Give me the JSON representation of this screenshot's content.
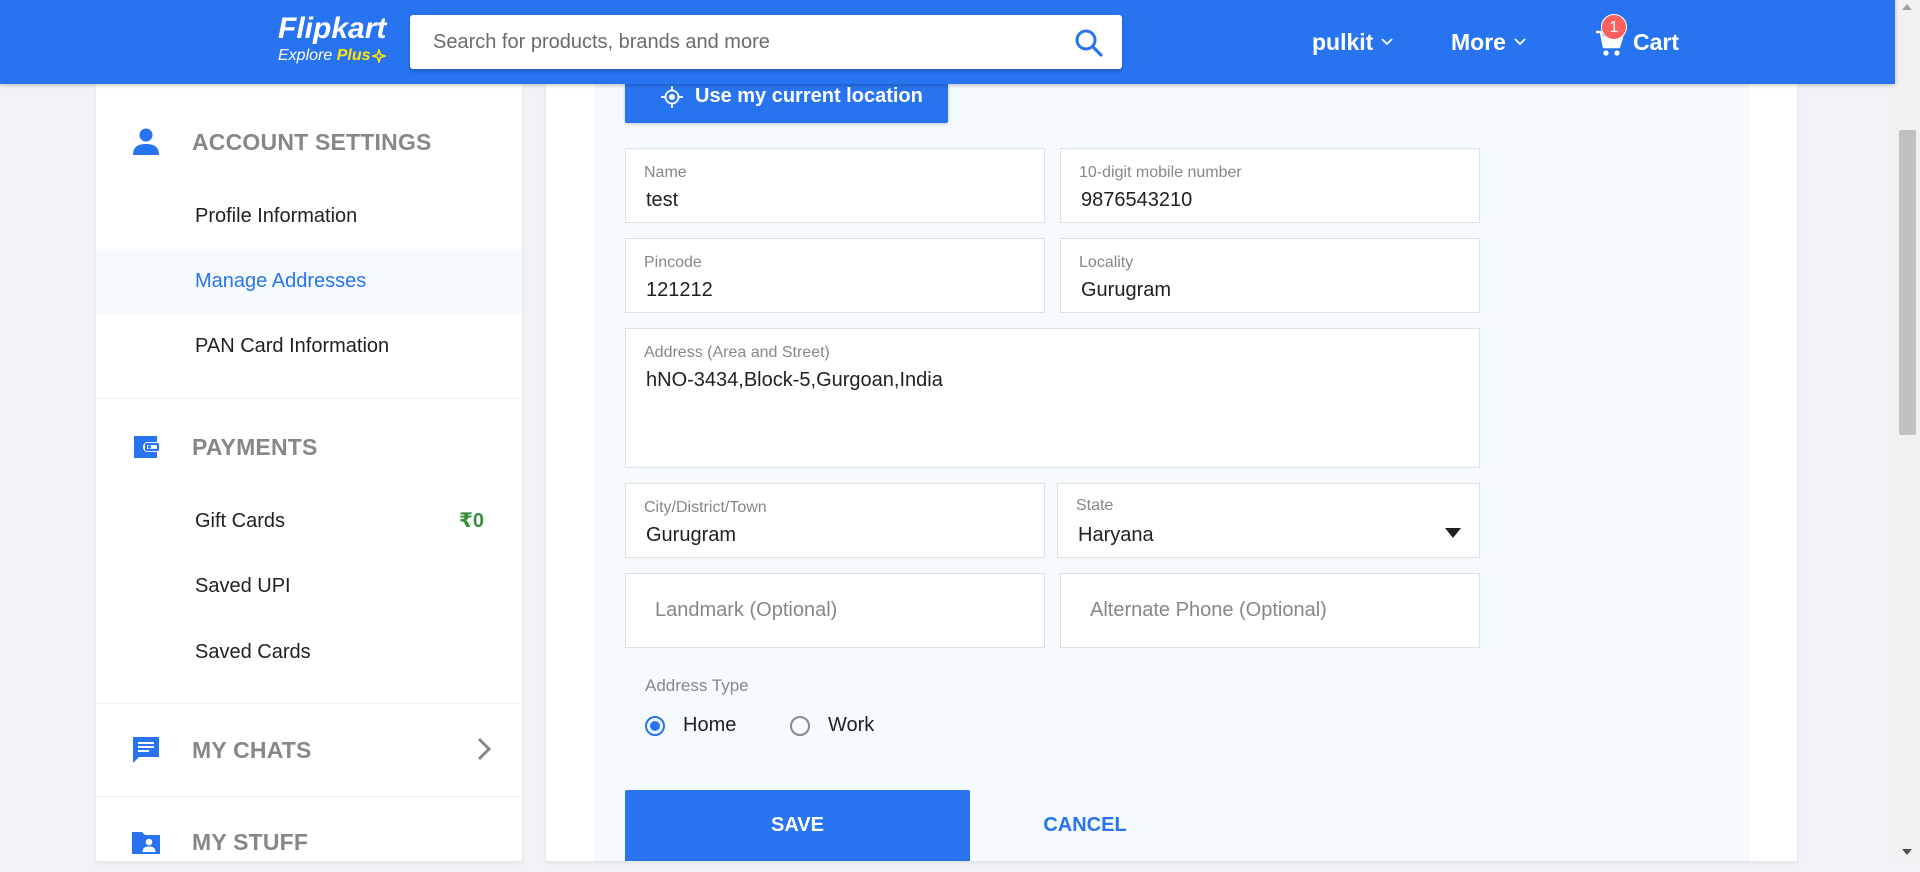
{
  "header": {
    "logo_main": "Flipkart",
    "logo_sub_prefix": "Explore ",
    "logo_sub_plus": "Plus",
    "search_placeholder": "Search for products, brands and more",
    "user_label": "pulkit",
    "more_label": "More",
    "cart_label": "Cart",
    "cart_count": "1",
    "brand_color": "#2874f0"
  },
  "sidebar": {
    "account_settings": {
      "title": "ACCOUNT SETTINGS",
      "icon": "user-icon",
      "items": [
        {
          "label": "Profile Information"
        },
        {
          "label": "Manage Addresses",
          "active": true
        },
        {
          "label": "PAN Card Information"
        }
      ]
    },
    "payments": {
      "title": "PAYMENTS",
      "icon": "wallet-icon",
      "items": [
        {
          "label": "Gift Cards",
          "amount": "₹0"
        },
        {
          "label": "Saved UPI"
        },
        {
          "label": "Saved Cards"
        }
      ]
    },
    "my_chats": {
      "title": "MY CHATS",
      "icon": "chat-icon"
    },
    "my_stuff": {
      "title": "MY STUFF",
      "icon": "folder-user-icon"
    }
  },
  "form": {
    "location_button": "Use my current location",
    "name": {
      "label": "Name",
      "value": "test"
    },
    "mobile": {
      "label": "10-digit mobile number",
      "value": "9876543210"
    },
    "pincode": {
      "label": "Pincode",
      "value": "121212"
    },
    "locality": {
      "label": "Locality",
      "value": "Gurugram"
    },
    "address": {
      "label": "Address (Area and Street)",
      "value": "hNO-3434,Block-5,Gurgoan,India"
    },
    "city": {
      "label": "City/District/Town",
      "value": "Gurugram"
    },
    "state": {
      "label": "State",
      "value": "Haryana"
    },
    "landmark": {
      "placeholder": "Landmark (Optional)"
    },
    "alt_phone": {
      "placeholder": "Alternate Phone (Optional)"
    },
    "address_type": {
      "label": "Address Type",
      "options": [
        {
          "label": "Home",
          "checked": true
        },
        {
          "label": "Work",
          "checked": false
        }
      ]
    },
    "save_label": "SAVE",
    "cancel_label": "CANCEL"
  }
}
